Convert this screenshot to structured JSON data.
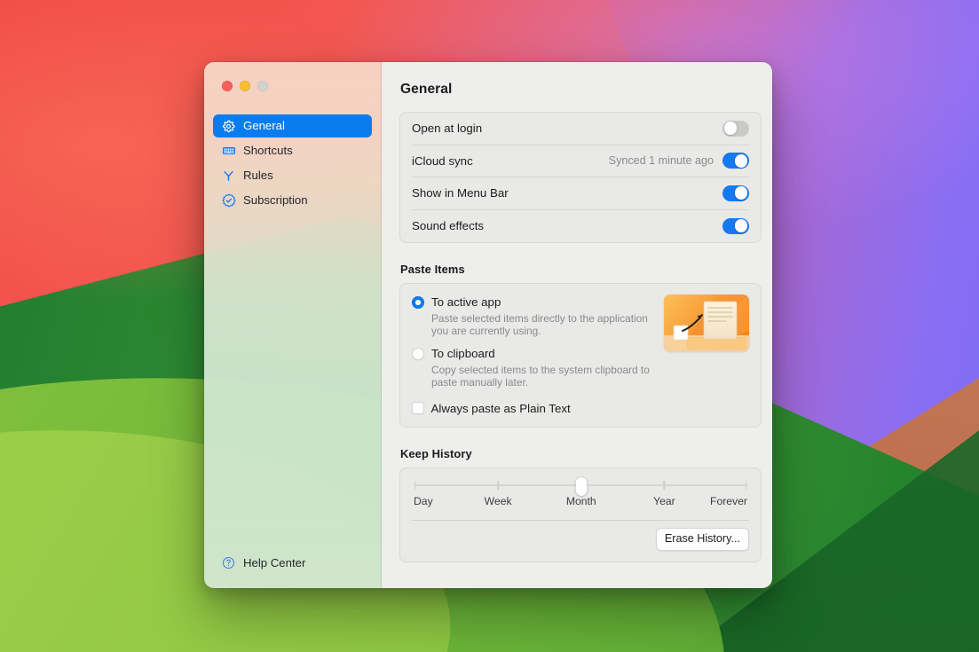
{
  "window": {
    "traffic_lights": [
      {
        "name": "close",
        "color": "#f5605a"
      },
      {
        "name": "minimize",
        "color": "#f9bd30"
      },
      {
        "name": "zoom",
        "color": "#d4d2cf"
      }
    ]
  },
  "sidebar": {
    "items": [
      {
        "label": "General",
        "icon": "gear-icon",
        "selected": true
      },
      {
        "label": "Shortcuts",
        "icon": "keyboard-icon",
        "selected": false
      },
      {
        "label": "Rules",
        "icon": "branch-icon",
        "selected": false
      },
      {
        "label": "Subscription",
        "icon": "seal-check-icon",
        "selected": false
      }
    ],
    "help": {
      "label": "Help Center",
      "icon": "question-circle-icon"
    }
  },
  "main": {
    "title": "General",
    "toggles": [
      {
        "label": "Open at login",
        "status": "",
        "state": "off"
      },
      {
        "label": "iCloud sync",
        "status": "Synced 1 minute ago",
        "state": "on"
      },
      {
        "label": "Show in Menu Bar",
        "status": "",
        "state": "on"
      },
      {
        "label": "Sound effects",
        "status": "",
        "state": "on"
      }
    ],
    "paste": {
      "section_title": "Paste Items",
      "options": [
        {
          "title": "To active app",
          "description": "Paste selected items directly to the application you are currently using.",
          "checked": true
        },
        {
          "title": "To clipboard",
          "description": "Copy selected items to the system clipboard to paste manually later.",
          "checked": false
        }
      ],
      "plain_text": {
        "label": "Always paste as Plain Text",
        "checked": false
      },
      "illustration": "paste-to-app-illustration"
    },
    "history": {
      "section_title": "Keep History",
      "slider": {
        "ticks": [
          "Day",
          "Week",
          "Month",
          "Year",
          "Forever"
        ],
        "value": "Month",
        "value_index": 2
      },
      "erase_button": "Erase History..."
    }
  },
  "colors": {
    "accent": "#0b7cf0",
    "toggle_on": "#1579f2",
    "toggle_off": "#c9c9c7",
    "content_bg": "#eeeeec",
    "card_bg": "#e9e9e7",
    "text_primary": "#1c1c1e",
    "text_secondary": "#8a8a8e"
  }
}
